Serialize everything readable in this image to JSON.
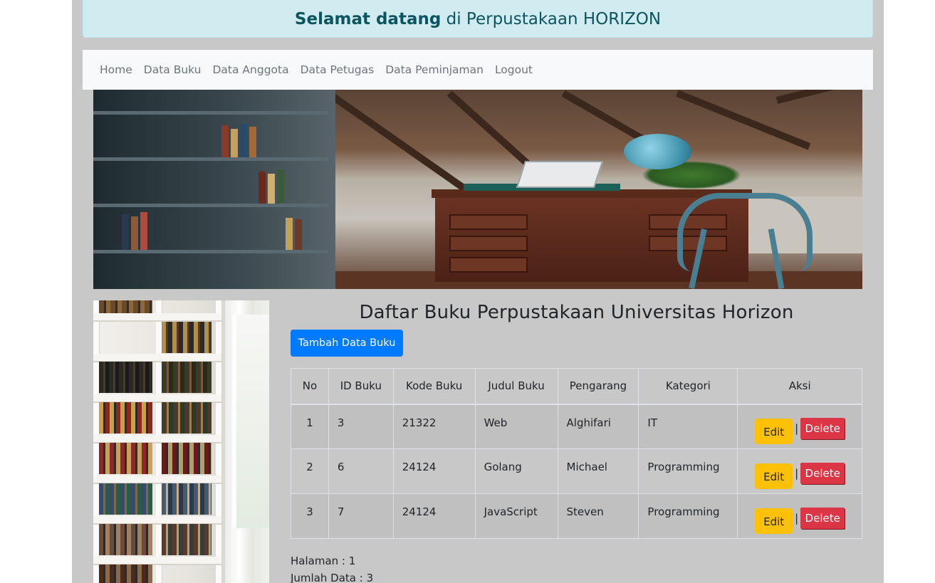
{
  "header": {
    "welcome_bold": "Selamat datang",
    "welcome_rest": " di Perpustakaan HORIZON"
  },
  "nav": {
    "items": [
      "Home",
      "Data Buku",
      "Data Anggota",
      "Data Petugas",
      "Data Peminjaman",
      "Logout"
    ]
  },
  "images": {
    "banner": "library-desk-banner-image",
    "side": "bookshelf-side-image"
  },
  "main": {
    "title": "Daftar Buku Perpustakaan Universitas Horizon",
    "add_button": "Tambah Data Buku",
    "table": {
      "headers": [
        "No",
        "ID Buku",
        "Kode Buku",
        "Judul Buku",
        "Pengarang",
        "Kategori",
        "Aksi"
      ],
      "rows": [
        {
          "no": "1",
          "id": "3",
          "kode": "21322",
          "judul": "Web",
          "pengarang": "Alghifari",
          "kategori": "IT",
          "edit": "Edit",
          "sep": "|",
          "delete": "Delete"
        },
        {
          "no": "2",
          "id": "6",
          "kode": "24124",
          "judul": "Golang",
          "pengarang": "Michael",
          "kategori": "Programming",
          "edit": "Edit",
          "sep": "|",
          "delete": "Delete"
        },
        {
          "no": "3",
          "id": "7",
          "kode": "24124",
          "judul": "JavaScript",
          "pengarang": "Steven",
          "kategori": "Programming",
          "edit": "Edit",
          "sep": "|",
          "delete": "Delete"
        }
      ]
    },
    "footer": {
      "halaman": "Halaman : 1",
      "jumlah": "Jumlah Data : 3"
    }
  },
  "colors": {
    "primary": "#007bff",
    "warning": "#ffc107",
    "danger": "#dc3545",
    "alert_bg": "#d1ecf1",
    "alert_text": "#0c5460",
    "frame_bg": "#c8c8c8"
  }
}
